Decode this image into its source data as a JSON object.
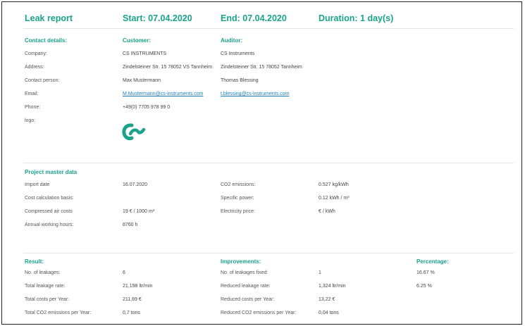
{
  "header": {
    "title": "Leak report",
    "start": "Start: 07.04.2020",
    "end": "End: 07.04.2020",
    "duration": "Duration: 1 day(s)"
  },
  "contact": {
    "section_label": "Contact details:",
    "customer_label": "Customer:",
    "auditor_label": "Auditor:",
    "fields": {
      "company": "Company:",
      "address": "Address:",
      "contact_person": "Contact person:",
      "email": "Email:",
      "phone": "Phone:",
      "logo": "logo:"
    },
    "customer": {
      "company": "CS INSTRUMENTS",
      "address": "Zindelsteiner Str. 15 78052 VS Tannheim",
      "contact_person": "Max Mustermann",
      "email": "M.Mustermann@cs-instruments.com",
      "phone": "+49(0) 7705 978 99 0"
    },
    "auditor": {
      "company": "CS Instruments",
      "address": "Zindelsteiner Str. 15 78052 Tannheim",
      "contact_person": "Thomas Blessing",
      "email": "t.blessing@cs-instruments.com"
    },
    "logo_color": "#1aa38a"
  },
  "master": {
    "section_label": "Project master data",
    "import_date_label": "Import date",
    "import_date": "16.07.2020",
    "cost_basis_label": "Cost calculation basis:",
    "air_costs_label": "Compressed air costs",
    "air_costs": "19 € / 1000 m³",
    "hours_label": "Annual working hours:",
    "hours": "8760 h",
    "co2_label": "CO2 emissions:",
    "co2": "0.527 kg/kWh",
    "power_label": "Specific power:",
    "power": "0.12 kWh / m³",
    "price_label": "Electricity price:",
    "price": "€ / kWh"
  },
  "result": {
    "section_label": "Result:",
    "improvements_label": "Improvements:",
    "percentage_label": "Percentage:",
    "rows": [
      {
        "label": "No. of leakages:",
        "value": "6",
        "imp_label": "No. of leakages fixed:",
        "imp_value": "1",
        "pct": "16.67 %"
      },
      {
        "label": "Total leakage rate:",
        "value": "21,198 ltr/min",
        "imp_label": "Reduced leakage rate:",
        "imp_value": "1,324 ltr/min",
        "pct": "6.25 %"
      },
      {
        "label": "Total costs per Year:",
        "value": "211,69 €",
        "imp_label": "Reduced costs per Year:",
        "imp_value": "13,22 €",
        "pct": ""
      },
      {
        "label": "Total CO2 emissions per Year:",
        "value": "0,7 tons",
        "imp_label": "Reduced CO2 emissions per Year:",
        "imp_value": "0,04 tons",
        "pct": ""
      }
    ]
  }
}
